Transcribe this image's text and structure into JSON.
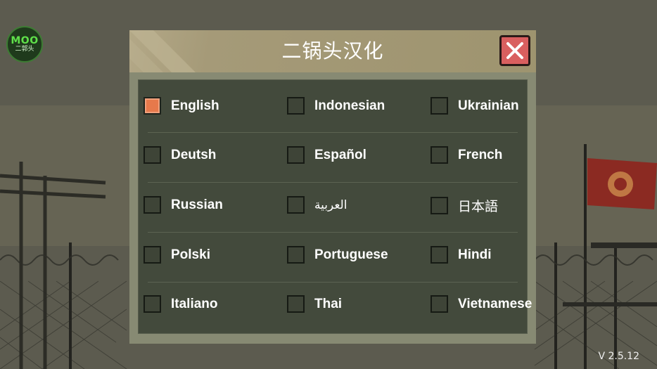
{
  "app": {
    "logo_text": "MOO",
    "logo_subtext": "二郭头",
    "version": "V 2.5.12"
  },
  "dialog": {
    "title": "二锅头汉化",
    "close_icon": "close-x-icon",
    "selected_language": "English",
    "rows": [
      [
        "English",
        "Indonesian",
        "Ukrainian"
      ],
      [
        "Deutsh",
        "Español",
        "French"
      ],
      [
        "Russian",
        "العربية",
        "日本語"
      ],
      [
        "Polski",
        "Portuguese",
        "Hindi"
      ],
      [
        "Italiano",
        "Thai",
        "Vietnamese"
      ]
    ]
  },
  "colors": {
    "checked_box": "#e7794b",
    "close_button": "#d95f5f",
    "header": "#a59a78",
    "panel": "#434a3c"
  }
}
